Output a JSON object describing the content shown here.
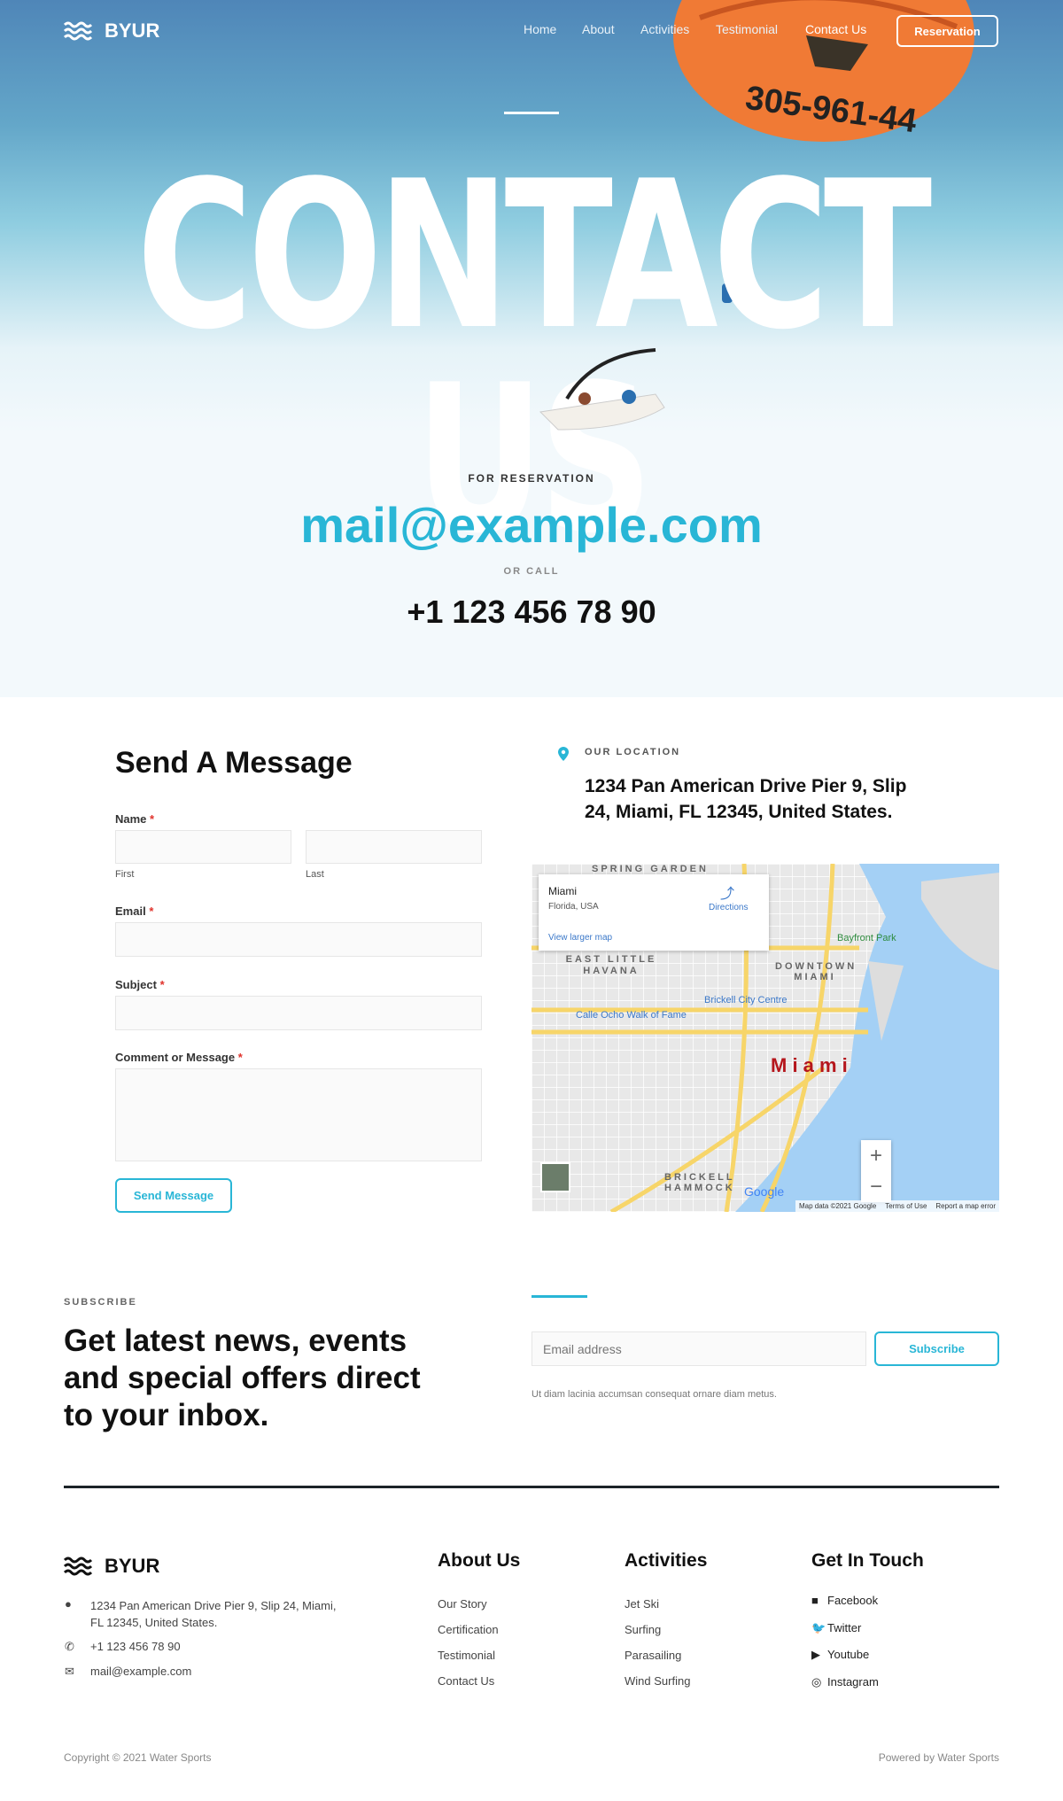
{
  "brand": "BYUR",
  "nav": {
    "items": [
      "Home",
      "About",
      "Activities",
      "Testimonial",
      "Contact Us"
    ],
    "reservation": "Reservation"
  },
  "hero": {
    "title": "CONTACT US",
    "balloon_number": "305-961-44"
  },
  "reservation": {
    "label": "FOR RESERVATION",
    "email": "mail@example.com",
    "or_call": "OR CALL",
    "phone": "+1 123 456 78 90"
  },
  "form": {
    "title": "Send A Message",
    "name_label": "Name",
    "first": "First",
    "last": "Last",
    "email_label": "Email",
    "subject_label": "Subject",
    "comment_label": "Comment or Message",
    "required": "*",
    "send": "Send Message"
  },
  "location": {
    "label": "OUR LOCATION",
    "address_line1": "1234 Pan American Drive Pier 9, Slip",
    "address_line2": "24, Miami, FL 12345, United States."
  },
  "map": {
    "place": "Miami",
    "region": "Florida, USA",
    "directions": "Directions",
    "larger": "View larger map",
    "city": "M i a m i",
    "labels": [
      "SPRING GARDEN",
      "EAST LITTLE HAVANA",
      "DOWNTOWN MIAMI",
      "Bayfront Park",
      "Brickell City Centre",
      "Calle Ocho Walk of Fame",
      "BRICKELL HAMMOCK"
    ],
    "attribution": "Map data ©2021 Google",
    "terms": "Terms of Use",
    "report": "Report a map error",
    "google": "Google",
    "zoom_in": "+",
    "zoom_out": "−"
  },
  "subscribe": {
    "label": "SUBSCRIBE",
    "heading": [
      "Get latest news, events",
      "and special offers direct",
      "to your inbox."
    ],
    "placeholder": "Email address",
    "button": "Subscribe",
    "note": "Ut diam lacinia accumsan consequat ornare diam metus."
  },
  "footer": {
    "address1": "1234 Pan American Drive Pier 9, Slip 24, Miami,",
    "address2": "FL 12345, United States.",
    "phone": "+1 123 456 78 90",
    "email": "mail@example.com",
    "columns": [
      {
        "title": "About Us",
        "links": [
          "Our Story",
          "Certification",
          "Testimonial",
          "Contact Us"
        ]
      },
      {
        "title": "Activities",
        "links": [
          "Jet Ski",
          "Surfing",
          "Parasailing",
          "Wind Surfing"
        ]
      }
    ],
    "social": {
      "title": "Get In Touch",
      "links": [
        "Facebook",
        "Twitter",
        "Youtube",
        "Instagram"
      ]
    },
    "copyright": "Copyright © 2021 Water Sports",
    "powered": "Powered by Water Sports"
  },
  "colors": {
    "accent": "#29b6d6",
    "dark": "#111111",
    "sky": "#4f86b8"
  }
}
